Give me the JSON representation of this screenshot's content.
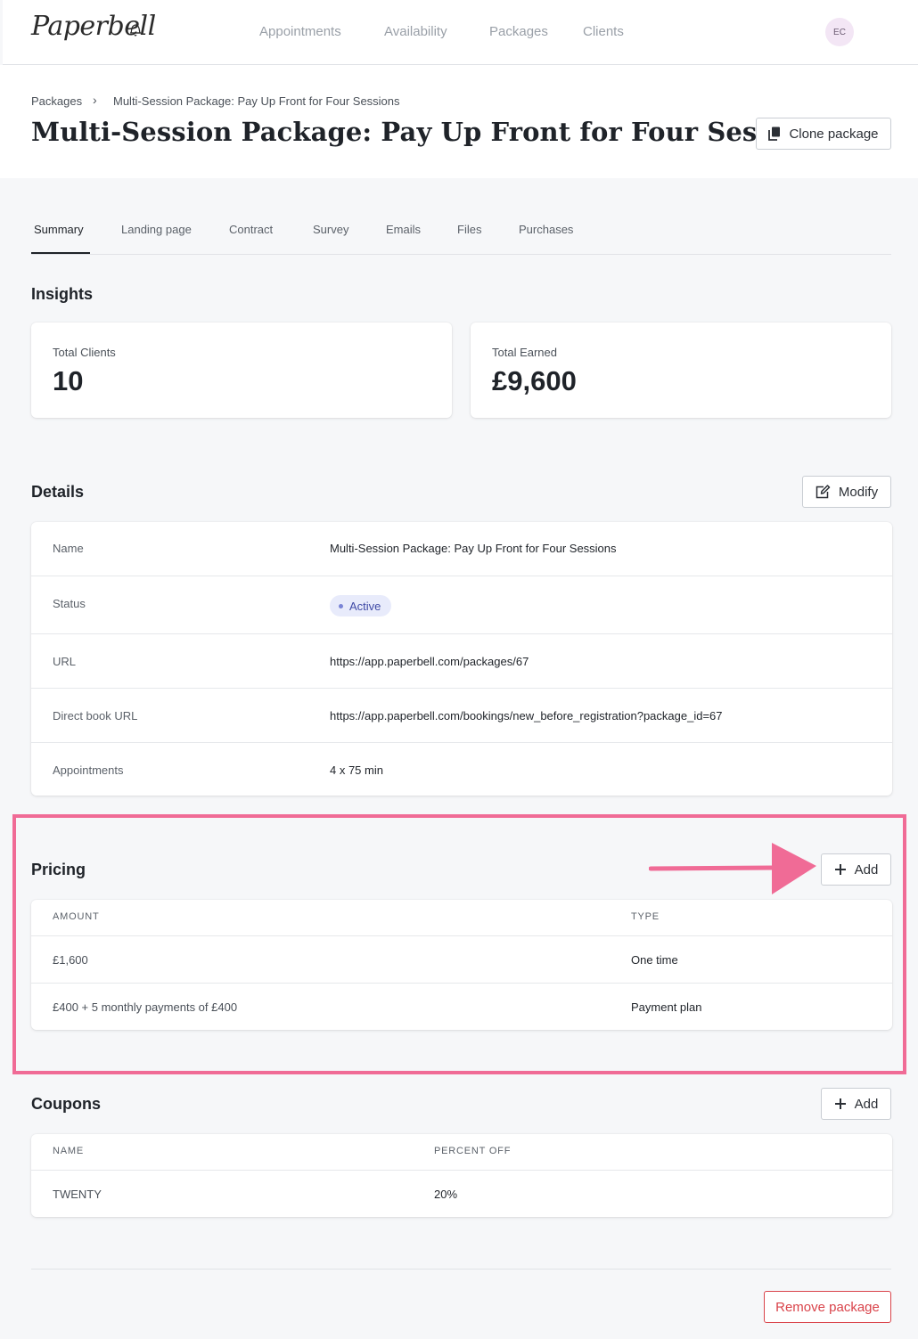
{
  "brand": {
    "name": "Paperbell",
    "accent": "#f06b96"
  },
  "nav": {
    "items": [
      "Appointments",
      "Availability",
      "Packages",
      "Clients"
    ],
    "avatar_initials": "EC"
  },
  "breadcrumb": {
    "parent": "Packages",
    "current": "Multi-Session Package: Pay Up Front for Four Sessions"
  },
  "page": {
    "title": "Multi-Session Package: Pay Up Front for Four Sessions",
    "clone_label": "Clone package"
  },
  "tabs": [
    "Summary",
    "Landing page",
    "Contract",
    "Survey",
    "Emails",
    "Files",
    "Purchases"
  ],
  "insights": {
    "title": "Insights",
    "total_clients_label": "Total Clients",
    "total_clients_value": "10",
    "total_earned_label": "Total Earned",
    "total_earned_value": "£9,600"
  },
  "details": {
    "title": "Details",
    "modify_label": "Modify",
    "rows": [
      {
        "label": "Name",
        "value": "Multi-Session Package: Pay Up Front for Four Sessions"
      },
      {
        "label": "Status",
        "value": "Active"
      },
      {
        "label": "URL",
        "value": "https://app.paperbell.com/packages/67"
      },
      {
        "label": "Direct book URL",
        "value": "https://app.paperbell.com/bookings/new_before_registration?package_id=67"
      },
      {
        "label": "Appointments",
        "value": "4 x 75 min"
      }
    ]
  },
  "pricing": {
    "title": "Pricing",
    "add_label": "Add",
    "headers": [
      "AMOUNT",
      "TYPE"
    ],
    "rows": [
      {
        "amount": "£1,600",
        "type": "One time"
      },
      {
        "amount": "£400 + 5 monthly payments of £400",
        "type": "Payment plan"
      }
    ]
  },
  "coupons": {
    "title": "Coupons",
    "add_label": "Add",
    "headers": [
      "NAME",
      "PERCENT OFF"
    ],
    "rows": [
      {
        "name": "TWENTY",
        "percent_off": "20%"
      }
    ]
  },
  "footer": {
    "remove_label": "Remove package"
  }
}
